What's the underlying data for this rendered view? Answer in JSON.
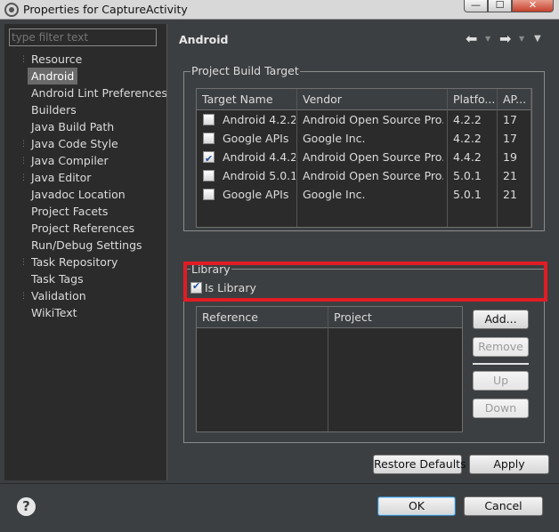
{
  "window": {
    "title": "Properties for CaptureActivity",
    "minimize_label": "—",
    "maximize_label": "☐",
    "close_label": "✕"
  },
  "filter": {
    "placeholder": "type filter text"
  },
  "tree": [
    {
      "label": "Resource",
      "expandable": true
    },
    {
      "label": "Android",
      "selected": true
    },
    {
      "label": "Android Lint Preferences"
    },
    {
      "label": "Builders"
    },
    {
      "label": "Java Build Path"
    },
    {
      "label": "Java Code Style",
      "expandable": true
    },
    {
      "label": "Java Compiler",
      "expandable": true
    },
    {
      "label": "Java Editor",
      "expandable": true
    },
    {
      "label": "Javadoc Location"
    },
    {
      "label": "Project Facets"
    },
    {
      "label": "Project References"
    },
    {
      "label": "Run/Debug Settings"
    },
    {
      "label": "Task Repository",
      "expandable": true
    },
    {
      "label": "Task Tags"
    },
    {
      "label": "Validation",
      "expandable": true
    },
    {
      "label": "WikiText"
    }
  ],
  "header": {
    "title": "Android",
    "back_icon": "⬅",
    "forward_icon": "➡",
    "dropdown_icon": "▼",
    "view_menu_icon": "▼"
  },
  "build_target": {
    "group_label": "Project Build Target",
    "columns": [
      "Target Name",
      "Vendor",
      "Platfo...",
      "AP..."
    ],
    "rows": [
      {
        "name": "Android 4.2.2",
        "vendor": "Android Open Source Pro...",
        "platform": "4.2.2",
        "api": "17",
        "checked": false
      },
      {
        "name": "Google APIs",
        "vendor": "Google Inc.",
        "platform": "4.2.2",
        "api": "17",
        "checked": false
      },
      {
        "name": "Android 4.4.2",
        "vendor": "Android Open Source Pro...",
        "platform": "4.4.2",
        "api": "19",
        "checked": true
      },
      {
        "name": "Android 5.0.1",
        "vendor": "Android Open Source Pro...",
        "platform": "5.0.1",
        "api": "21",
        "checked": false
      },
      {
        "name": "Google APIs",
        "vendor": "Google Inc.",
        "platform": "5.0.1",
        "api": "21",
        "checked": false
      }
    ]
  },
  "library": {
    "group_label": "Library",
    "is_library_label": "Is Library",
    "is_library_checked": true,
    "highlight_color": "#e01c24",
    "columns": [
      "Reference",
      "Project"
    ],
    "buttons": {
      "add": "Add...",
      "remove": "Remove",
      "up": "Up",
      "down": "Down"
    }
  },
  "page_buttons": {
    "restore_defaults": "Restore Defaults",
    "apply": "Apply"
  },
  "dialog_buttons": {
    "ok": "OK",
    "cancel": "Cancel",
    "help": "?"
  }
}
